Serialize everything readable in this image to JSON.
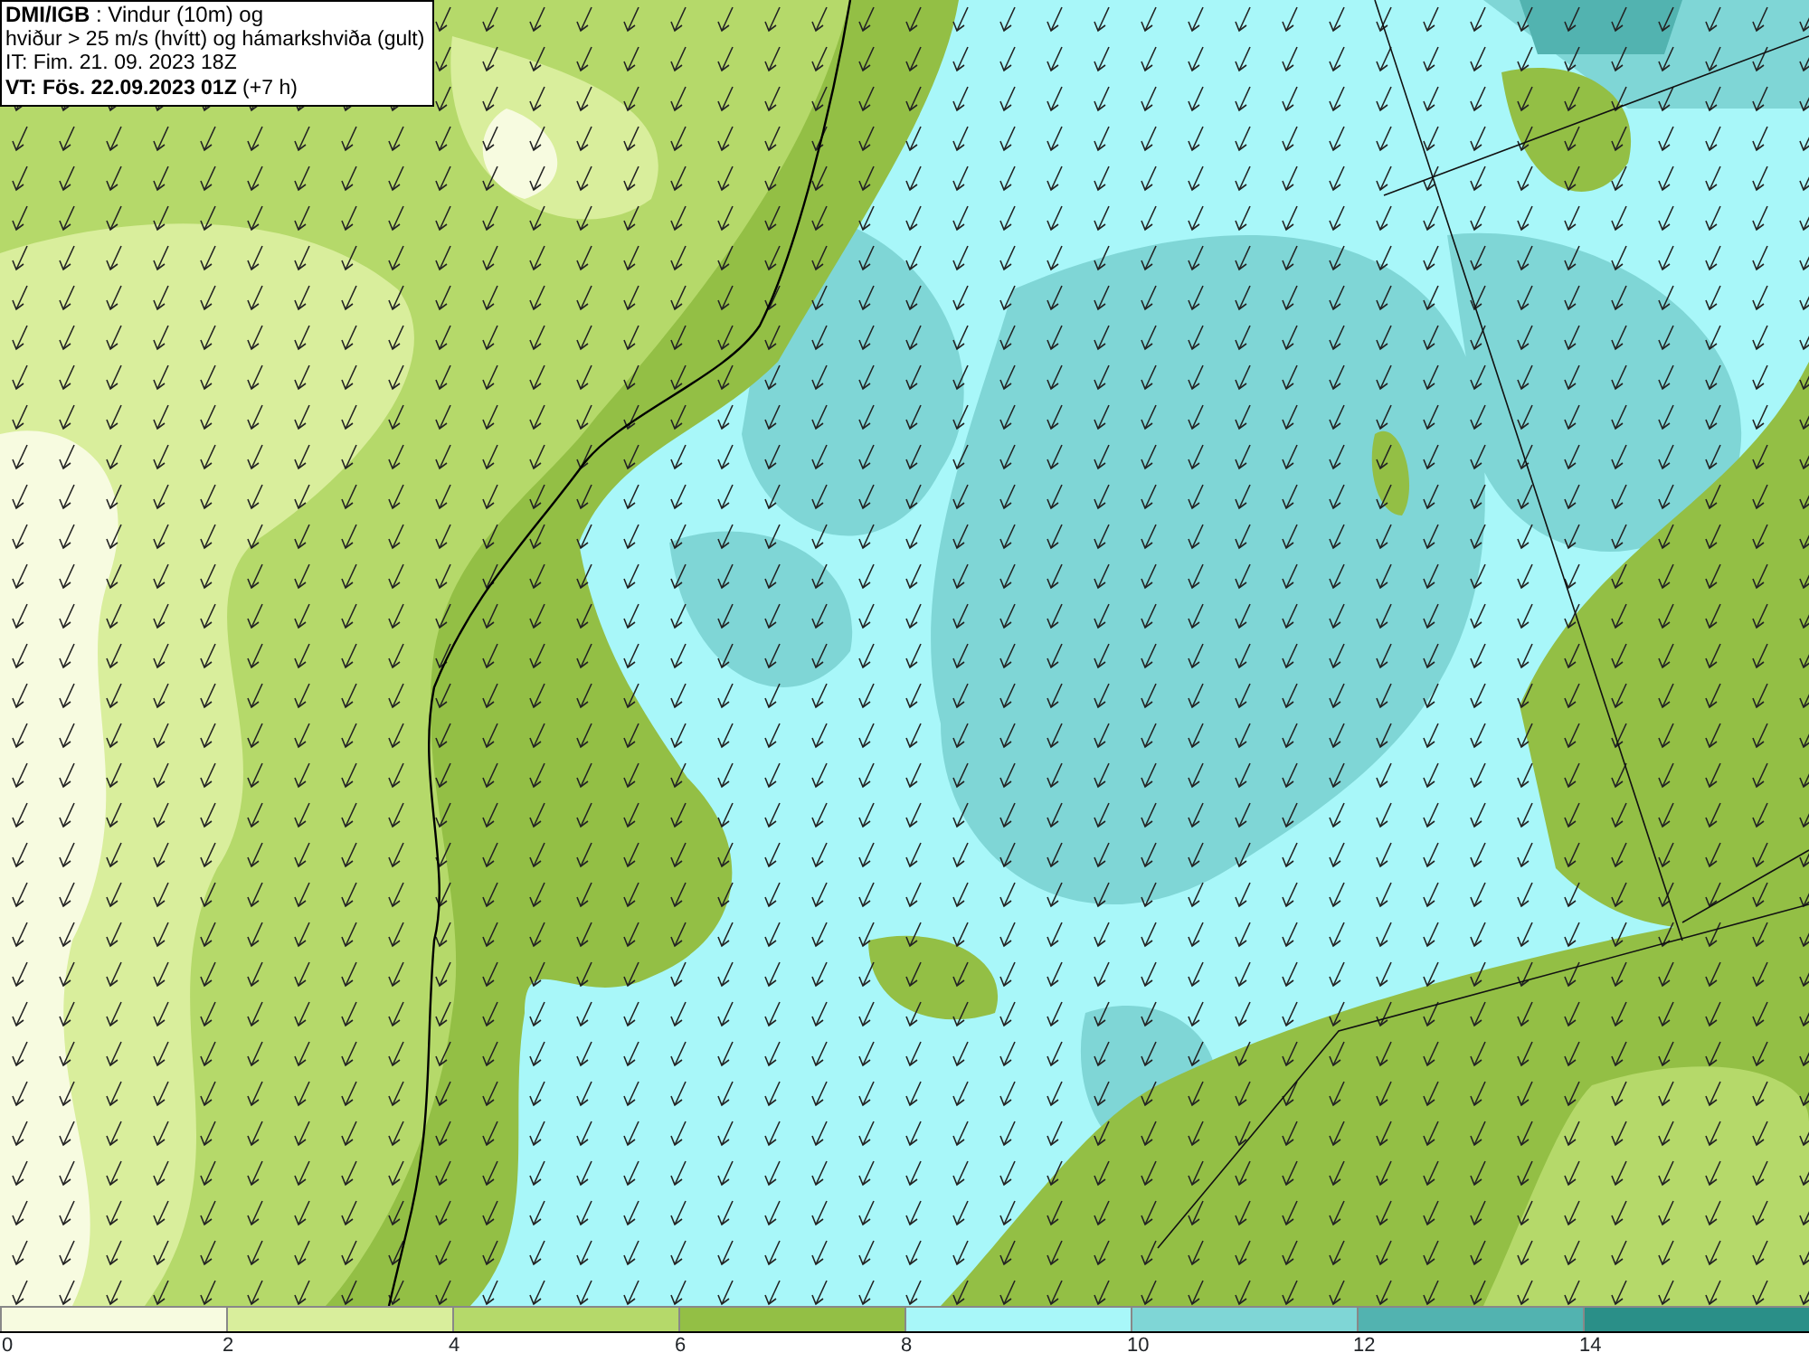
{
  "header": {
    "lines": [
      "**DMI/IGB** : Vindur (10m) og",
      "hviður > 25 m/s (hvítt) og hámarkshviða (gult)",
      "IT: Fim. 21. 09. 2023 18Z",
      "**VT: Fös. 22.09.2023 01Z** (+7 h)"
    ]
  },
  "legend": {
    "bins": [
      {
        "label": "0",
        "color": "#f7fbe0"
      },
      {
        "label": "2",
        "color": "#d9ee9c"
      },
      {
        "label": "4",
        "color": "#b5d96a"
      },
      {
        "label": "6",
        "color": "#93bf45"
      },
      {
        "label": "8",
        "color": "#a8f7f9"
      },
      {
        "label": "10",
        "color": "#7fd6d6"
      },
      {
        "label": "12",
        "color": "#52b3b0"
      },
      {
        "label": "14",
        "color": "#2a8f88"
      }
    ]
  }
}
